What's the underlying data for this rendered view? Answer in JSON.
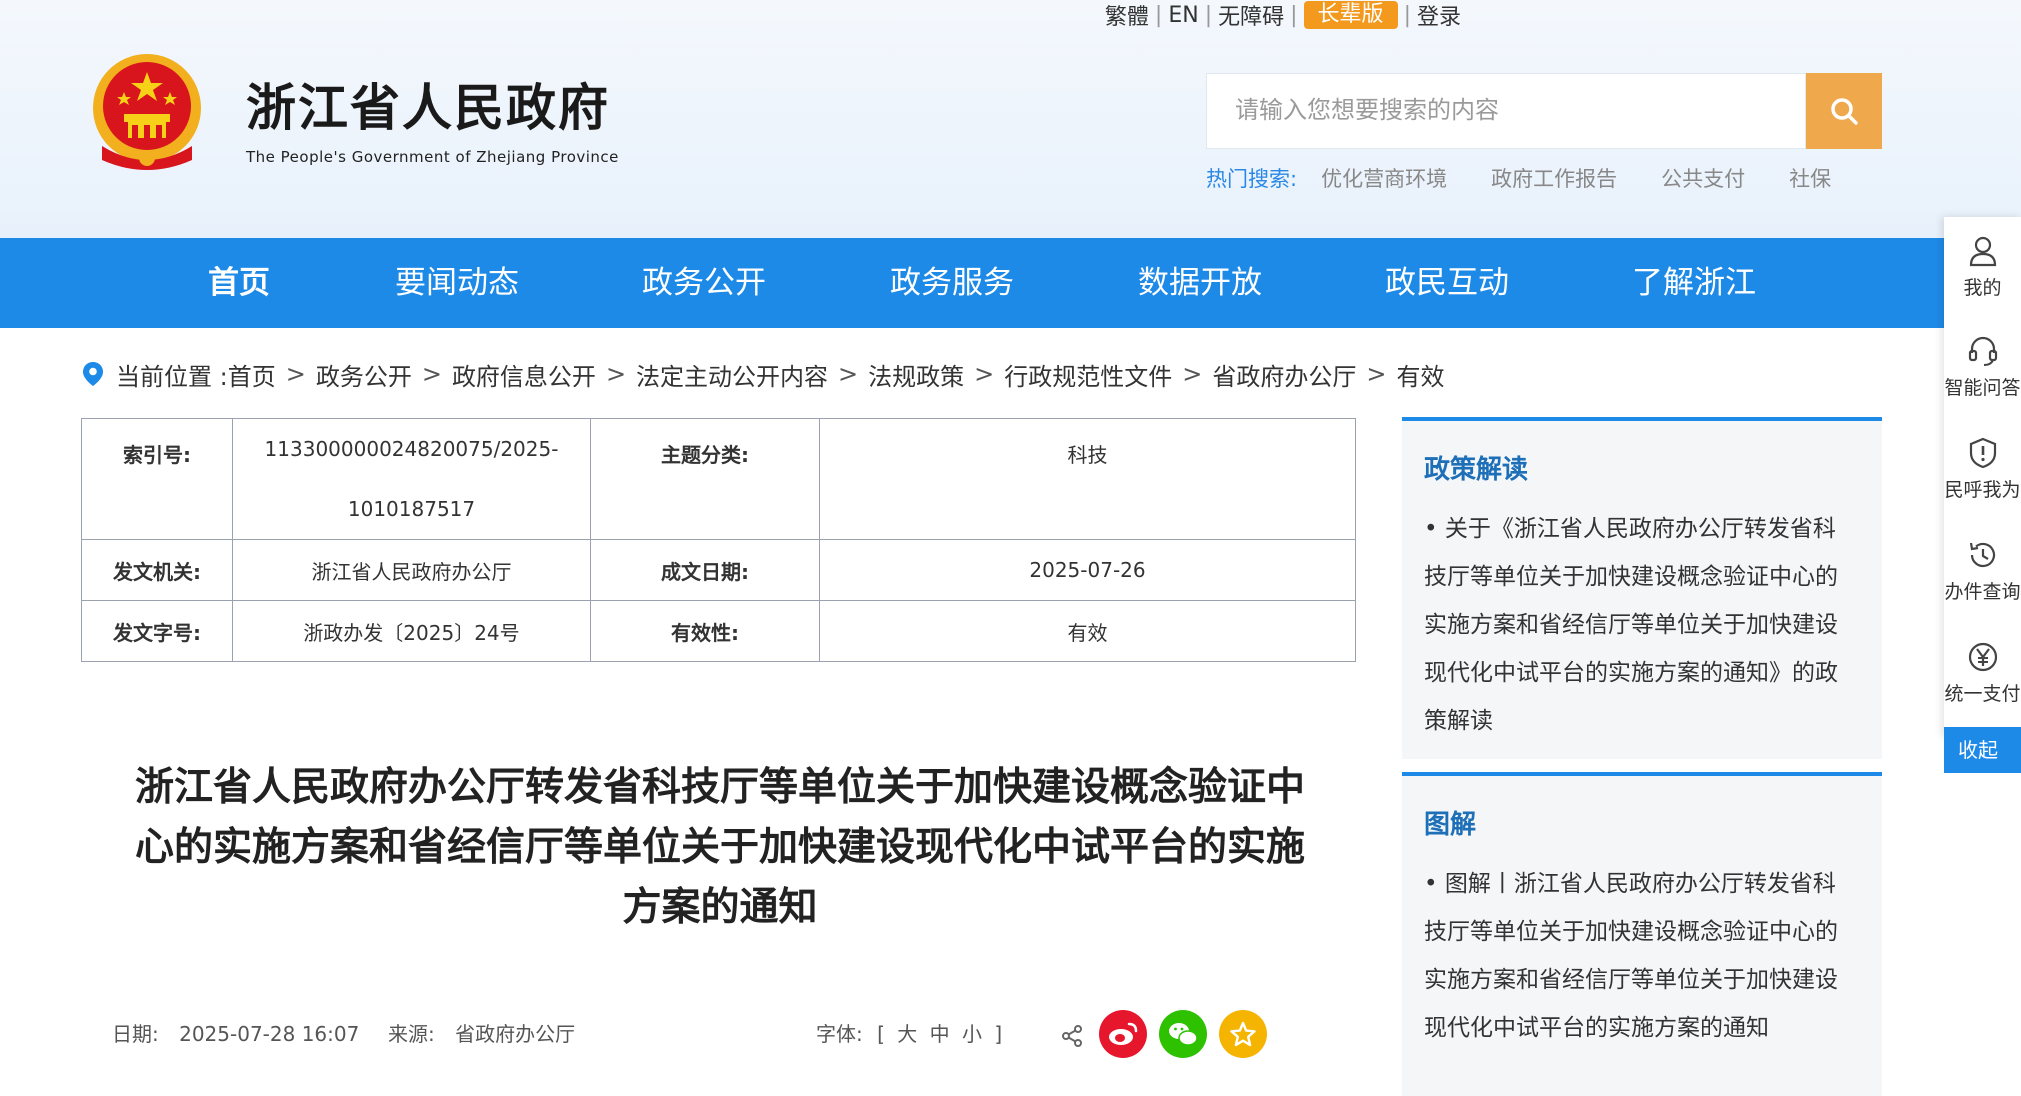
{
  "top_links": {
    "traditional": "繁體",
    "english": "EN",
    "accessible": "无障碍",
    "elder": "长辈版",
    "login": "登录"
  },
  "site": {
    "title": "浙江省人民政府",
    "subtitle": "The People's Government of Zhejiang Province"
  },
  "search": {
    "placeholder": "请输入您想要搜索的内容",
    "hot_label": "热门搜索:",
    "hot_items": [
      "优化营商环境",
      "政府工作报告",
      "公共支付",
      "社保"
    ]
  },
  "nav": {
    "items": [
      "首页",
      "要闻动态",
      "政务公开",
      "政务服务",
      "数据开放",
      "政民互动",
      "了解浙江"
    ]
  },
  "breadcrumb": {
    "prefix": "当前位置 :",
    "items": [
      "首页",
      "政务公开",
      "政府信息公开",
      "法定主动公开内容",
      "法规政策",
      "行政规范性文件",
      "省政府办公厅",
      "有效"
    ]
  },
  "info_table": {
    "index_label": "索引号:",
    "index_value_1": "113300000024820075/2025-",
    "index_value_2": "1010187517",
    "topic_label": "主题分类:",
    "topic_value": "科技",
    "issuer_label": "发文机关:",
    "issuer_value": "浙江省人民政府办公厅",
    "date_label": "成文日期:",
    "date_value": "2025-07-26",
    "docno_label": "发文字号:",
    "docno_value": "浙政办发〔2025〕24号",
    "validity_label": "有效性:",
    "validity_value": "有效"
  },
  "article": {
    "title_line1": "浙江省人民政府办公厅转发省科技厅等单位关于加快建设概念验证中",
    "title_line2": "心的实施方案和省经信厅等单位关于加快建设现代化中试平台的实施",
    "title_line3": "方案的通知",
    "date_label": "日期:",
    "date_value": "2025-07-28 16:07",
    "source_label": "来源:",
    "source_value": "省政府办公厅",
    "font_label": "字体:",
    "font_open": "[",
    "font_large": "大",
    "font_medium": "中",
    "font_small": "小",
    "font_close": "]"
  },
  "side_panels": {
    "policy_title": "政策解读",
    "policy_link": "关于《浙江省人民政府办公厅转发省科技厅等单位关于加快建设概念验证中心的实施方案和省经信厅等单位关于加快建设现代化中试平台的实施方案的通知》的政策解读",
    "graphic_title": "图解",
    "graphic_link": "图解丨浙江省人民政府办公厅转发省科技厅等单位关于加快建设概念验证中心的实施方案和省经信厅等单位关于加快建设现代化中试平台的实施方案的通知"
  },
  "float_bar": {
    "items": [
      "我的",
      "智能问答",
      "民呼我为",
      "办件查询",
      "统一支付"
    ],
    "collapse": "收起"
  },
  "colors": {
    "primary": "#1e8ae8",
    "search_btn": "#f0a84c",
    "elder_badge": "#f39a1e",
    "weibo": "#e6162d",
    "wechat": "#2dc100",
    "favorite": "#f5b400"
  }
}
